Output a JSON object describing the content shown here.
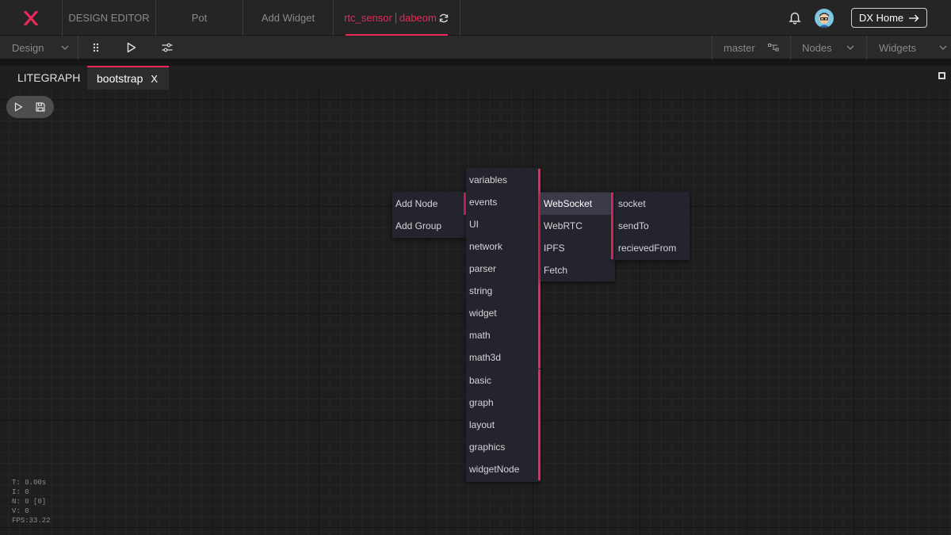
{
  "topbar": {
    "logo_text": "X",
    "tabs": [
      "DESIGN EDITOR",
      "Pot",
      "Add Widget"
    ],
    "active_tab": {
      "name": "rtc_sensor",
      "suffix": "dabeom"
    },
    "dx_home": "DX Home"
  },
  "toolbar": {
    "design_select": "Design",
    "branch": "master",
    "nodes_select": "Nodes",
    "widgets_select": "Widgets"
  },
  "editor_tabs": [
    "LITEGRAPH",
    "bootstrap"
  ],
  "editor_tab_close": "X",
  "context_menu": {
    "root": [
      "Add Node",
      "Add Group"
    ],
    "categories": [
      "variables",
      "events",
      "UI",
      "network",
      "parser",
      "string",
      "widget",
      "math",
      "math3d",
      "basic",
      "graph",
      "layout",
      "graphics",
      "widgetNode"
    ],
    "events": [
      "WebSocket",
      "WebRTC",
      "IPFS",
      "Fetch"
    ],
    "websocket": [
      "socket",
      "sendTo",
      "recievedFrom"
    ]
  },
  "stats": {
    "t": "T: 0.00s",
    "i": "I: 0",
    "n": "N: 0 [0]",
    "v": "V: 0",
    "fps": "FPS:33.22"
  },
  "colors": {
    "accent": "#e6285a",
    "menu_bg": "#24242e",
    "canvas_bg": "#1e1e1e"
  },
  "icons": [
    "x-logo-icon",
    "refresh-icon",
    "bell-icon",
    "avatar",
    "arrow-right-icon",
    "chevron-down-icon",
    "drag-grid-icon",
    "play-icon",
    "sliders-icon",
    "branch-icon",
    "maximize-icon",
    "save-icon"
  ]
}
